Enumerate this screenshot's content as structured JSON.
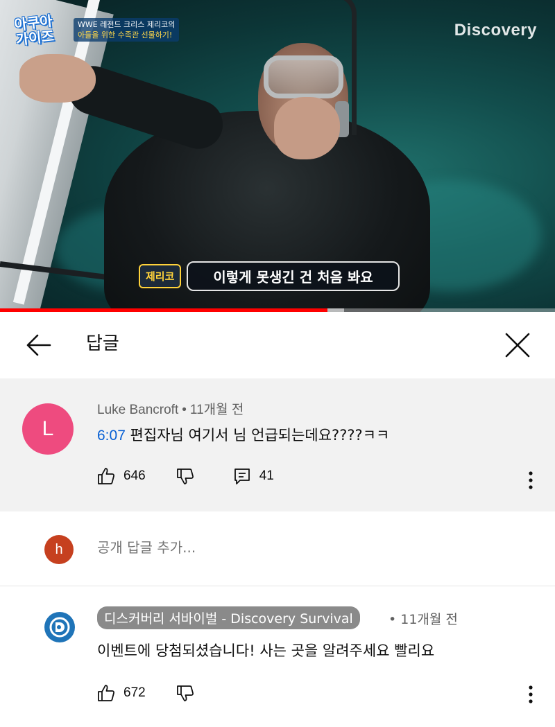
{
  "video": {
    "show_logo_line1": "아쿠아",
    "show_logo_line2": "가이즈",
    "episode_line1": "WWE 레전드 크리스 제리코의",
    "episode_line2": "아들을 위한 수족관 선물하기!",
    "brand": "Discovery",
    "speaker": "제리코",
    "subtitle": "이렇게 못생긴 건 처음 봐요",
    "progress_fraction": 0.59,
    "buffer_fraction": 0.62,
    "accent_color": "#ff0000"
  },
  "header": {
    "title": "답글",
    "back_icon": "arrow-left-icon",
    "close_icon": "close-icon"
  },
  "parent_comment": {
    "avatar_letter": "L",
    "avatar_color": "#ee4b7f",
    "author": "Luke Bancroft",
    "separator": "•",
    "time": "11개월 전",
    "timestamp_link": "6:07",
    "text": " 편집자님 여기서 님 언급되는데요????ㅋㅋ",
    "likes": "646",
    "replies": "41"
  },
  "add_reply": {
    "avatar_letter": "h",
    "avatar_color": "#c6401f",
    "placeholder": "공개 답글 추가..."
  },
  "reply_comment": {
    "channel_name": "디스커버리 서바이벌 - Discovery Survival",
    "time": "• 11개월 전",
    "text": "이벤트에 당첨되셨습니다! 사는 곳을 알려주세요 빨리요",
    "likes": "672"
  }
}
